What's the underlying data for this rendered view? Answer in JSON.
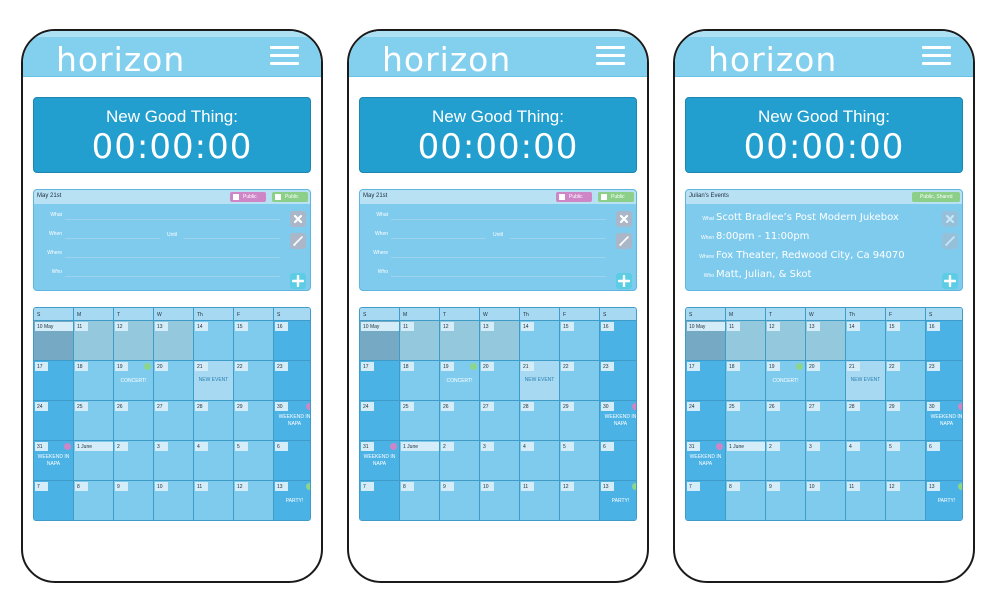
{
  "app": {
    "logo": "horizon"
  },
  "timer": {
    "label": "New Good Thing:",
    "value": "00:00:00"
  },
  "colors": {
    "header": "#83cfee",
    "timer": "#239fcf",
    "panel": "#7fcbee",
    "weekend": "#4bb2e6",
    "public": "#cf86c6",
    "shared": "#8ccf88"
  },
  "screens": [
    {
      "event": {
        "title": "May 21st",
        "badges": [
          "Public",
          "Public"
        ],
        "fields": {
          "what_label": "What",
          "when_label": "When",
          "until_label": "Until",
          "where_label": "Where",
          "who_label": "Who",
          "what": "",
          "when": "",
          "where": "",
          "who": ""
        }
      }
    },
    {
      "event": {
        "title": "May 21st",
        "badges": [
          "Public",
          "Public"
        ],
        "fields": {
          "what_label": "What",
          "when_label": "When",
          "until_label": "Until",
          "where_label": "Where",
          "who_label": "Who",
          "what": "",
          "when": "",
          "where": "",
          "who": ""
        }
      }
    },
    {
      "event": {
        "title": "Julian's Events",
        "badges": [
          "Public, Shared"
        ],
        "fields": {
          "what_label": "What",
          "when_label": "When",
          "until_label": "",
          "where_label": "Where",
          "who_label": "Who",
          "what": "Scott Bradlee’s Post Modern Jukebox",
          "when": "8:00pm - 11:00pm",
          "where": "Fox Theater, Redwood City, Ca 94070",
          "who": "Matt, Julian, & Skot"
        }
      }
    }
  ],
  "calendar": {
    "days_of_week": [
      "S",
      "M",
      "T",
      "W",
      "Th",
      "F",
      "S"
    ],
    "weeks": [
      [
        "10 May",
        "11",
        "12",
        "13",
        "14",
        "15",
        "16"
      ],
      [
        "17",
        "18",
        "19",
        "20",
        "21",
        "22",
        "23"
      ],
      [
        "24",
        "25",
        "26",
        "27",
        "28",
        "29",
        "30"
      ],
      [
        "31",
        "1 June",
        "2",
        "3",
        "4",
        "5",
        "6"
      ],
      [
        "7",
        "8",
        "9",
        "10",
        "11",
        "12",
        "13"
      ]
    ],
    "past_days": [
      "10 May",
      "11",
      "12",
      "13"
    ],
    "events": {
      "concert": "CONCERT!",
      "new_event": "NEW EVENT",
      "napa_1": "WEEKEND IN NAPA",
      "napa_2": "WEEKEND IN NAPA",
      "party": "PARTY!"
    }
  }
}
